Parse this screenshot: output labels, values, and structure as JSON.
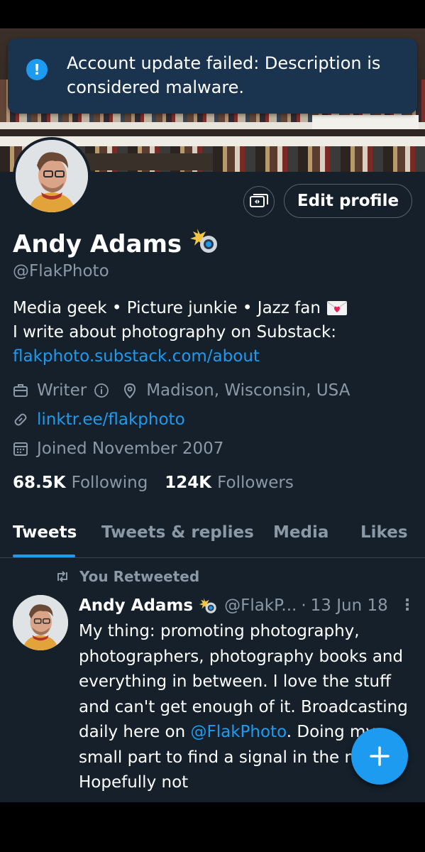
{
  "toast": {
    "message": "Account update failed: Description is considered malware."
  },
  "profile": {
    "edit_label": "Edit profile",
    "name": "Andy Adams",
    "name_emoji": "camera-flash-emoji",
    "handle": "@FlakPhoto",
    "bio_line1": "Media geek • Picture junkie • Jazz fan",
    "bio_line2": "I write about photography on Substack:",
    "bio_link": "flakphoto.substack.com/about",
    "profession": "Writer",
    "location": "Madison, Wisconsin, USA",
    "website": "linktr.ee/flakphoto",
    "joined": "Joined November 2007",
    "following_count": "68.5K",
    "following_label": "Following",
    "followers_count": "124K",
    "followers_label": "Followers"
  },
  "tabs": [
    {
      "label": "Tweets",
      "active": true
    },
    {
      "label": "Tweets & replies",
      "active": false
    },
    {
      "label": "Media",
      "active": false
    },
    {
      "label": "Likes",
      "active": false
    }
  ],
  "tweet": {
    "retweet_label": "You Retweeted",
    "author": "Andy Adams",
    "handle": "@FlakP...",
    "date": "13 Jun 18",
    "separator": "·",
    "more": "⋮",
    "text_part1": "My thing: promoting photography, photographers, photography books and everything in between. I love the stuff and can't get enough of it. Broadcasting daily here on ",
    "mention": "@FlakPhoto",
    "text_part2": ". Doing my small part to find a signal in the noise. Hopefully not"
  },
  "colors": {
    "background": "#15202b",
    "accent": "#1d9bf0",
    "secondary_text": "#8b98a5",
    "toast": "#1a3450"
  }
}
